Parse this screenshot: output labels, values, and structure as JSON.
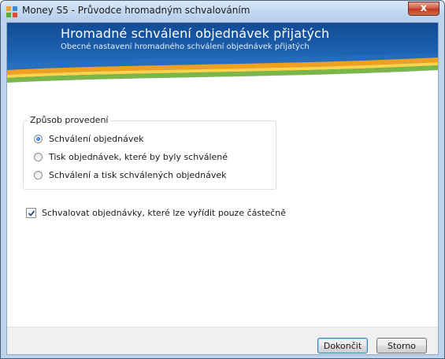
{
  "window": {
    "title": "Money S5 - Průvodce hromadným schvalováním",
    "close_label": "x",
    "icon": "money-s5-app-icon"
  },
  "banner": {
    "title": "Hromadné schválení objednávek přijatých",
    "subtitle": "Obecné nastavení hromadného schválení objednávek přijatých"
  },
  "method_group": {
    "legend": "Způsob provedení",
    "options": [
      {
        "label": "Schválení objednávek",
        "selected": true
      },
      {
        "label": "Tisk objednávek, které by byly schválené",
        "selected": false
      },
      {
        "label": "Schválení a tisk schválených objednávek",
        "selected": false
      }
    ]
  },
  "partial_checkbox": {
    "label": "Schvalovat objednávky, které lze vyřídit pouze částečně",
    "checked": true
  },
  "buttons": {
    "finish": "Dokončit",
    "cancel": "Storno"
  },
  "colors": {
    "banner_blue": "#1f66b6",
    "stripe_orange": "#f0a020",
    "stripe_green": "#7ab648",
    "close_red": "#c0381e",
    "default_button_border": "#3c7fb1"
  }
}
